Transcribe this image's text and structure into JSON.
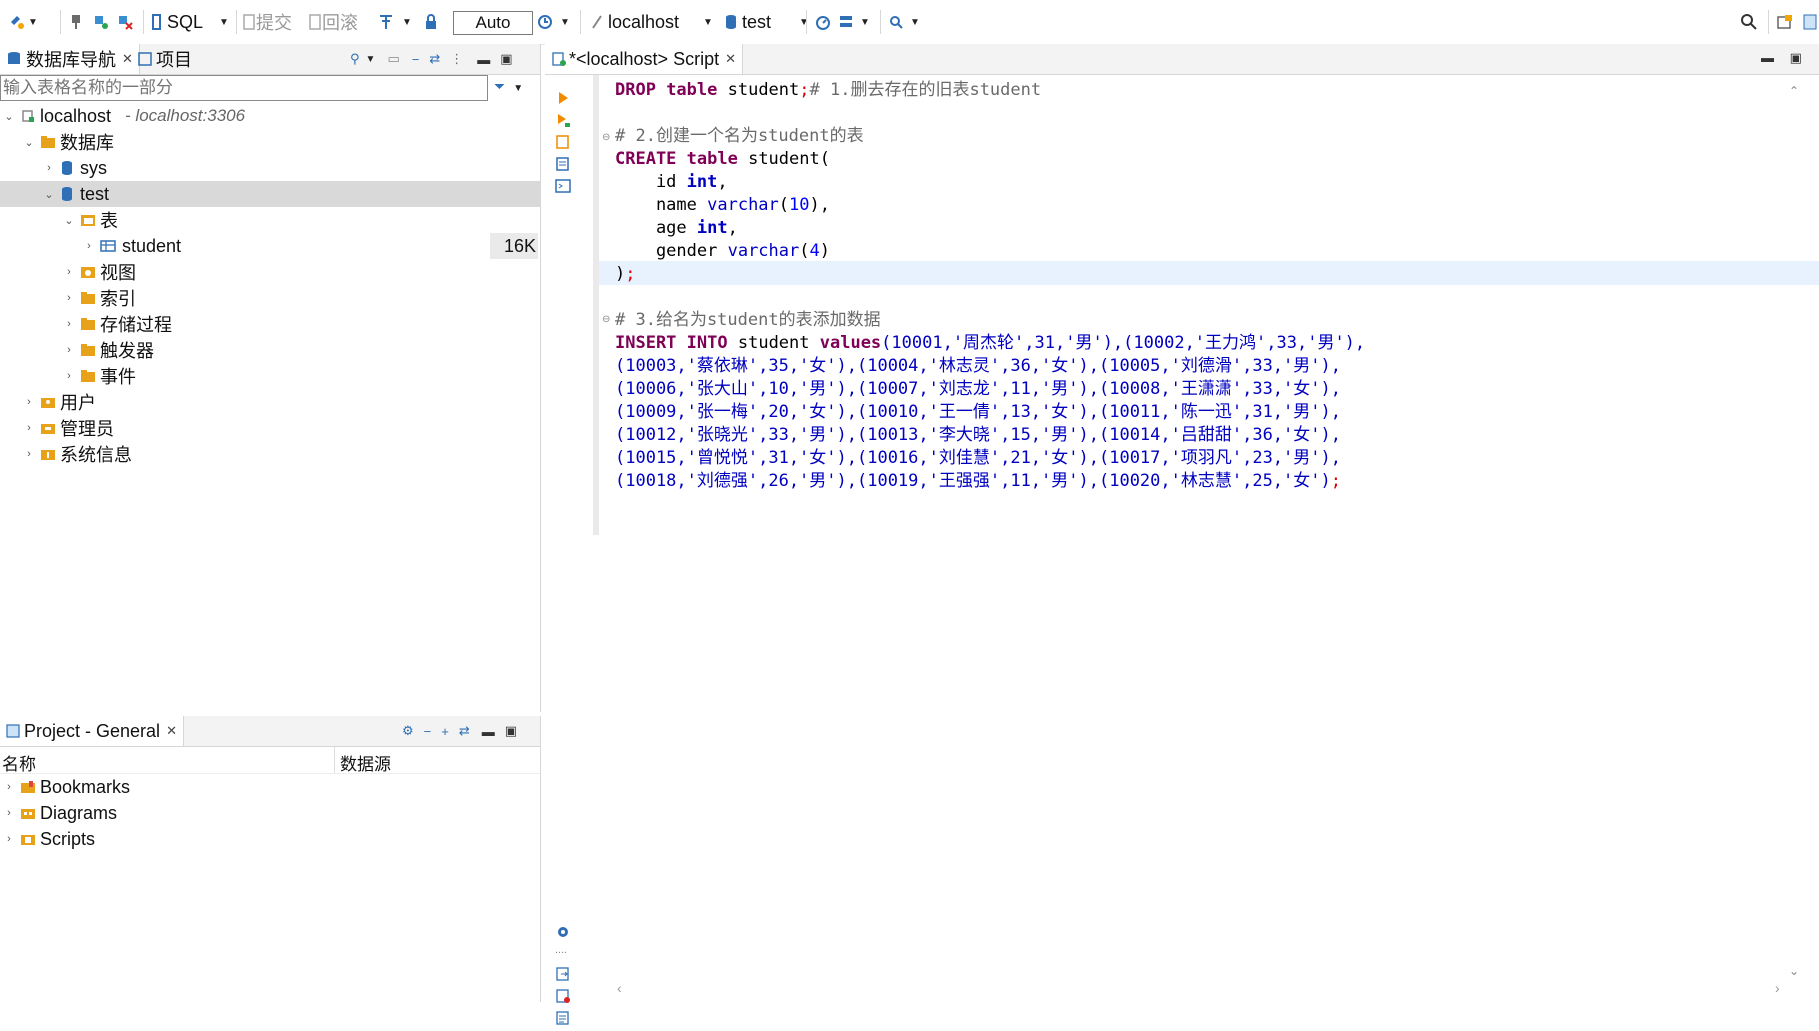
{
  "toolbar": {
    "sql_label": "SQL",
    "commit_label": "提交",
    "rollback_label": "回滚",
    "mode_value": "Auto",
    "connection_label": "localhost",
    "database_label": "test"
  },
  "nav": {
    "tab_navigator": "数据库导航",
    "tab_projects": "项目",
    "filter_placeholder": "输入表格名称的一部分",
    "tree": {
      "host": "localhost",
      "host_sub": "- localhost:3306",
      "databases": "数据库",
      "sys": "sys",
      "test": "test",
      "tables": "表",
      "student": "student",
      "student_size": "16K",
      "views": "视图",
      "indexes": "索引",
      "procedures": "存储过程",
      "triggers": "触发器",
      "events": "事件",
      "users": "用户",
      "admins": "管理员",
      "sysinfo": "系统信息"
    }
  },
  "project": {
    "tab_label": "Project - General",
    "col_name": "名称",
    "col_source": "数据源",
    "items": [
      "Bookmarks",
      "Diagrams",
      "Scripts"
    ]
  },
  "editor": {
    "tab_label": "*<localhost> Script",
    "code": {
      "l1_a": "DROP",
      "l1_b": " table ",
      "l1_c": "student",
      "l1_d": ";",
      "l1_e": "# 1.删去存在的旧表student",
      "l3": "# 2.创建一个名为student的表",
      "l4_a": "CREATE",
      "l4_b": " table ",
      "l4_c": "student(",
      "l5_a": "    id ",
      "l5_b": "int",
      "l5_c": ",",
      "l6_a": "    name ",
      "l6_b": "varchar",
      "l6_c": "(",
      "l6_d": "10",
      "l6_e": "),",
      "l7_a": "    age ",
      "l7_b": "int",
      "l7_c": ",",
      "l8_a": "    gender ",
      "l8_b": "varchar",
      "l8_c": "(",
      "l8_d": "4",
      "l8_e": ")",
      "l9_a": ")",
      "l9_b": ";",
      "l11": "# 3.给名为student的表添加数据",
      "l12_a": "INSERT",
      "l12_b": " ",
      "l12_c": "INTO",
      "l12_d": " student ",
      "l12_e": "values",
      "l12_f": "(10001,'周杰轮',31,'男'),(10002,'王力鸿',33,'男'),",
      "l13": "(10003,'蔡依琳',35,'女'),(10004,'林志灵',36,'女'),(10005,'刘德滑',33,'男'),",
      "l14": "(10006,'张大山',10,'男'),(10007,'刘志龙',11,'男'),(10008,'王潇潇',33,'女'),",
      "l15": "(10009,'张一梅',20,'女'),(10010,'王一倩',13,'女'),(10011,'陈一迅',31,'男'),",
      "l16": "(10012,'张晓光',33,'男'),(10013,'李大晓',15,'男'),(10014,'吕甜甜',36,'女'),",
      "l17": "(10015,'曾悦悦',31,'女'),(10016,'刘佳慧',21,'女'),(10017,'项羽凡',23,'男'),",
      "l18_a": "(10018,'刘德强',26,'男'),(10019,'王强强',11,'男'),(10020,'林志慧',25,'女')",
      "l18_b": ";"
    }
  },
  "colors": {
    "keyword": "#7f0055",
    "type": "#0000c0",
    "string": "#2a8a2a",
    "comment": "#6a6a6a",
    "selection": "#d9d9d9",
    "current_line": "#e8f2fe"
  },
  "icons": [
    "new-connection-icon",
    "plug-icon",
    "disconnect-icon",
    "sql-editor-icon",
    "commit-icon",
    "rollback-icon",
    "transaction-icon",
    "lock-icon",
    "history-icon",
    "connection-icon",
    "database-icon",
    "dashboard-icon",
    "navigator-icon",
    "search-icon",
    "perspective-icon",
    "run-statement-icon",
    "run-script-icon",
    "explain-icon",
    "format-icon",
    "terminal-icon",
    "settings-icon"
  ]
}
